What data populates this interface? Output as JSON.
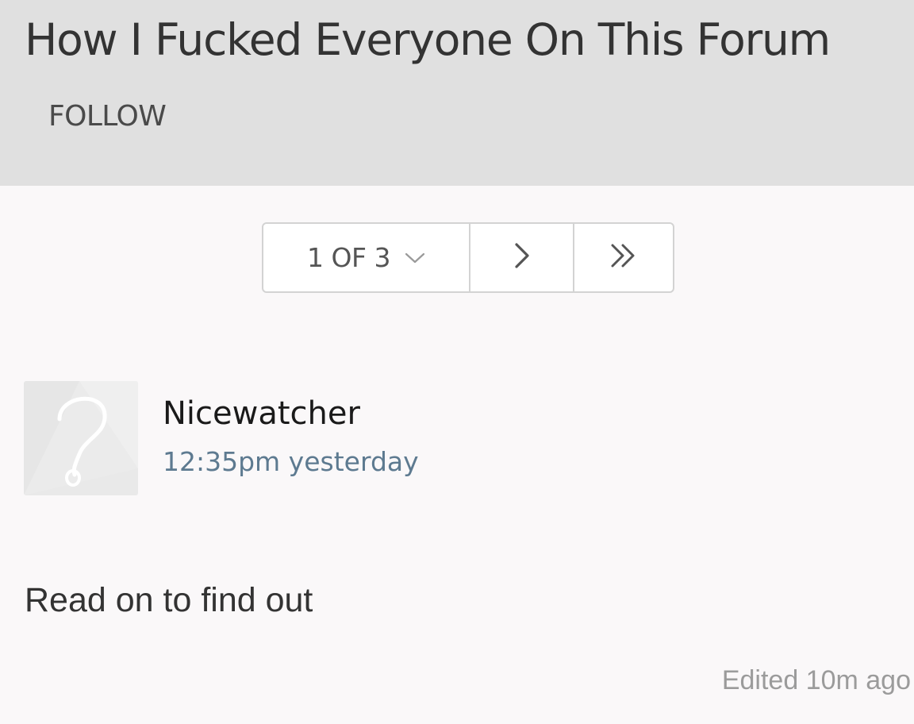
{
  "topic": {
    "title": "How I Fucked Everyone On This Forum",
    "follow_label": "FOLLOW"
  },
  "pagination": {
    "label": "1 OF 3",
    "icons": {
      "dropdown": "chevron-down-icon",
      "next": "chevron-right-icon",
      "last": "double-chevron-right-icon"
    }
  },
  "post": {
    "author": "Nicewatcher",
    "timestamp": "12:35pm yesterday",
    "avatar_icon": "question-mark-icon",
    "body": "Read on to find out",
    "edited_note": "Edited 10m ago"
  },
  "colors": {
    "header_background": "#e0e0e0",
    "page_background": "#faf8f9",
    "timestamp_link": "#5d7a90",
    "muted_text": "#9b9b9b"
  }
}
